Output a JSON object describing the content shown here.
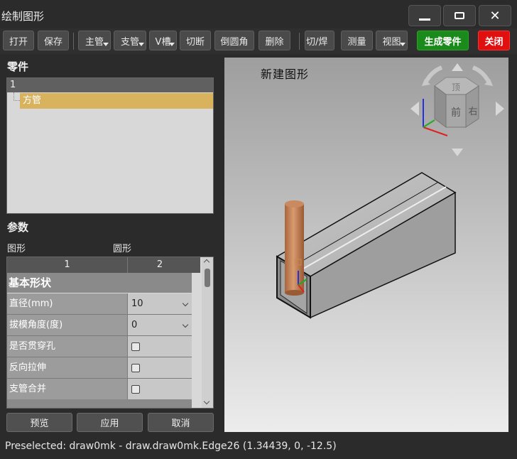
{
  "window": {
    "title": "绘制图形"
  },
  "toolbar": {
    "open": "打开",
    "save": "保存",
    "main_pipe": "主管",
    "branch_pipe": "支管",
    "v_groove": "V槽",
    "cut": "切断",
    "fillet": "倒圆角",
    "delete": "删除",
    "cut_weld": "切/焊",
    "measure": "测量",
    "view": "视图",
    "generate": "生成零件",
    "close": "关闭"
  },
  "parts": {
    "heading": "零件",
    "column": "1",
    "items": [
      "方管"
    ]
  },
  "params": {
    "heading": "参数",
    "shape1": "图形",
    "shape2": "圆形",
    "columns": [
      "1",
      "2"
    ],
    "group": "基本形状",
    "rows": [
      {
        "label": "直径(mm)",
        "value": "10"
      },
      {
        "label": "拔模角度(度)",
        "value": "0"
      },
      {
        "label": "是否贯穿孔",
        "value": ""
      },
      {
        "label": "反向拉伸",
        "value": ""
      },
      {
        "label": "支管合并",
        "value": ""
      }
    ]
  },
  "actions": {
    "preview": "预览",
    "apply": "应用",
    "cancel": "取消"
  },
  "viewport": {
    "label": "新建图形",
    "navcube": {
      "top": "顶",
      "front": "前",
      "right": "右"
    }
  },
  "status": "Preselected: draw0mk - draw.draw0mk.Edge26 (1.34439, 0, -12.5)",
  "colors": {
    "accent_selected": "#d9b25e",
    "generate_btn": "#1a8a1a",
    "close_btn": "#e01010"
  }
}
